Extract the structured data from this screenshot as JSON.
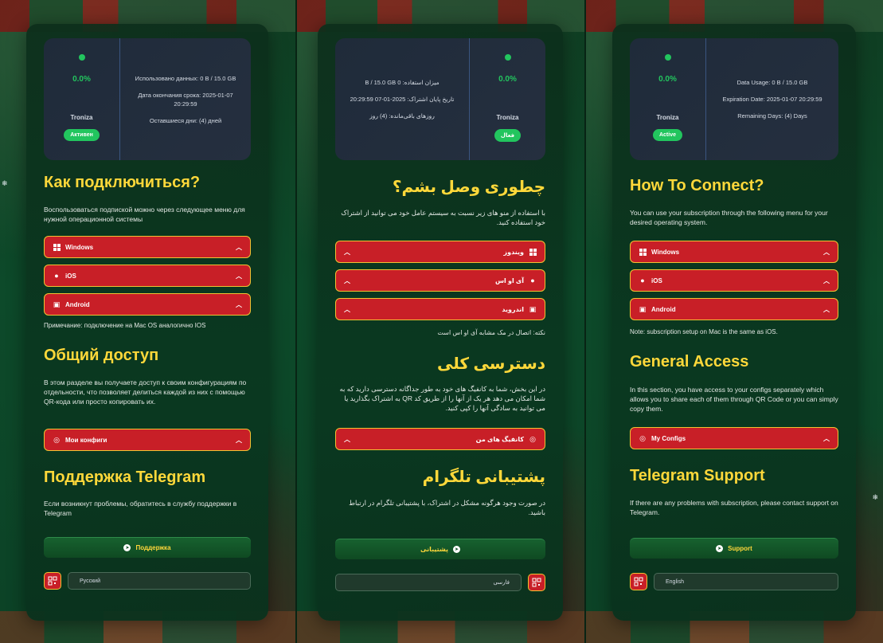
{
  "panels": [
    {
      "lang": "ru",
      "status": {
        "pct": "0.0%",
        "username": "Troniza",
        "badge": "Активен",
        "data_usage": "Использовано данных: 0 B / 15.0 GB",
        "expiry": "Дата окончания срока: 2025-01-07 20:29:59",
        "remaining": "Оставшиеся дни: (4) дней"
      },
      "connect_title": "Как подключиться?",
      "connect_text": "Воспользоваться подпиской можно через следующее меню для нужной операционной системы",
      "os_buttons": [
        "Windows",
        "iOS",
        "Android"
      ],
      "mac_note": "Примечание: подключение на Mac OS аналогично IOS",
      "access_title": "Общий доступ",
      "access_text": "В этом разделе вы получаете доступ к своим конфигурациям по отдельности, что позволяет делиться каждой из них с помощью QR-кода или просто копировать их.",
      "configs_button": "Мои конфиги",
      "support_title": "Поддержка Telegram",
      "support_text": "Если возникнут проблемы, обратитесь в службу поддержки в Telegram",
      "support_button": "Поддержка",
      "language": "Русский"
    },
    {
      "lang": "fa",
      "status": {
        "pct": "0.0%",
        "username": "Troniza",
        "badge": "فعال",
        "data_usage": "میزان استفاده: 0 B / 15.0 GB",
        "expiry": "تاریخ پایان اشتراک: 2025-01-07 20:29:59",
        "remaining": "روزهای باقی‌مانده: (4) روز"
      },
      "connect_title": "چطوری وصل بشم؟",
      "connect_text": "با استفاده از منو های زیر نسبت به سیستم عامل خود می توانید از اشتراک خود استفاده کنید.",
      "os_buttons": [
        "ویندوز",
        "آی او اس",
        "اندروید"
      ],
      "mac_note": "نکته: اتصال در مک مشابه آی او اس است",
      "access_title": "دسترسی کلی",
      "access_text": "در این بخش، شما به کانفیگ های خود به طور جداگانه دسترسی دارید که به شما امکان می دهد هر یک از آنها را از طریق کد QR به اشتراک بگذارید یا می توانید به سادگی آنها را کپی کنید.",
      "configs_button": "کانفیگ های من",
      "support_title": "پشتیبانی تلگرام",
      "support_text": "در صورت وجود هرگونه مشکل در اشتراک، با پشتیبانی تلگرام در ارتباط باشید.",
      "support_button": "پشتیبانی",
      "language": "فارسی"
    },
    {
      "lang": "en",
      "status": {
        "pct": "0.0%",
        "username": "Troniza",
        "badge": "Active",
        "data_usage": "Data Usage: 0 B / 15.0 GB",
        "expiry": "Expiration Date: 2025-01-07 20:29:59",
        "remaining": "Remaining Days: (4) Days"
      },
      "connect_title": "How To Connect?",
      "connect_text": "You can use your subscription through the following menu for your desired operating system.",
      "os_buttons": [
        "Windows",
        "iOS",
        "Android"
      ],
      "mac_note": "Note: subscription setup on Mac is the same as iOS.",
      "access_title": "General Access",
      "access_text": "In this section, you have access to your configs separately which allows you to share each of them through QR Code or you can simply copy them.",
      "configs_button": "My Configs",
      "support_title": "Telegram Support",
      "support_text": "If there are any problems with subscription, please contact support on Telegram.",
      "support_button": "Support",
      "language": "English"
    }
  ],
  "colors": {
    "accent_yellow": "#ffd83a",
    "button_red": "#c81f27",
    "status_green": "#22c55e",
    "border_gold": "#f1c232"
  },
  "icons": [
    "windows-icon",
    "apple-icon",
    "android-icon",
    "globe-icon",
    "telegram-icon",
    "qr-code-icon",
    "chevron-up-icon",
    "snowflake-icon"
  ]
}
